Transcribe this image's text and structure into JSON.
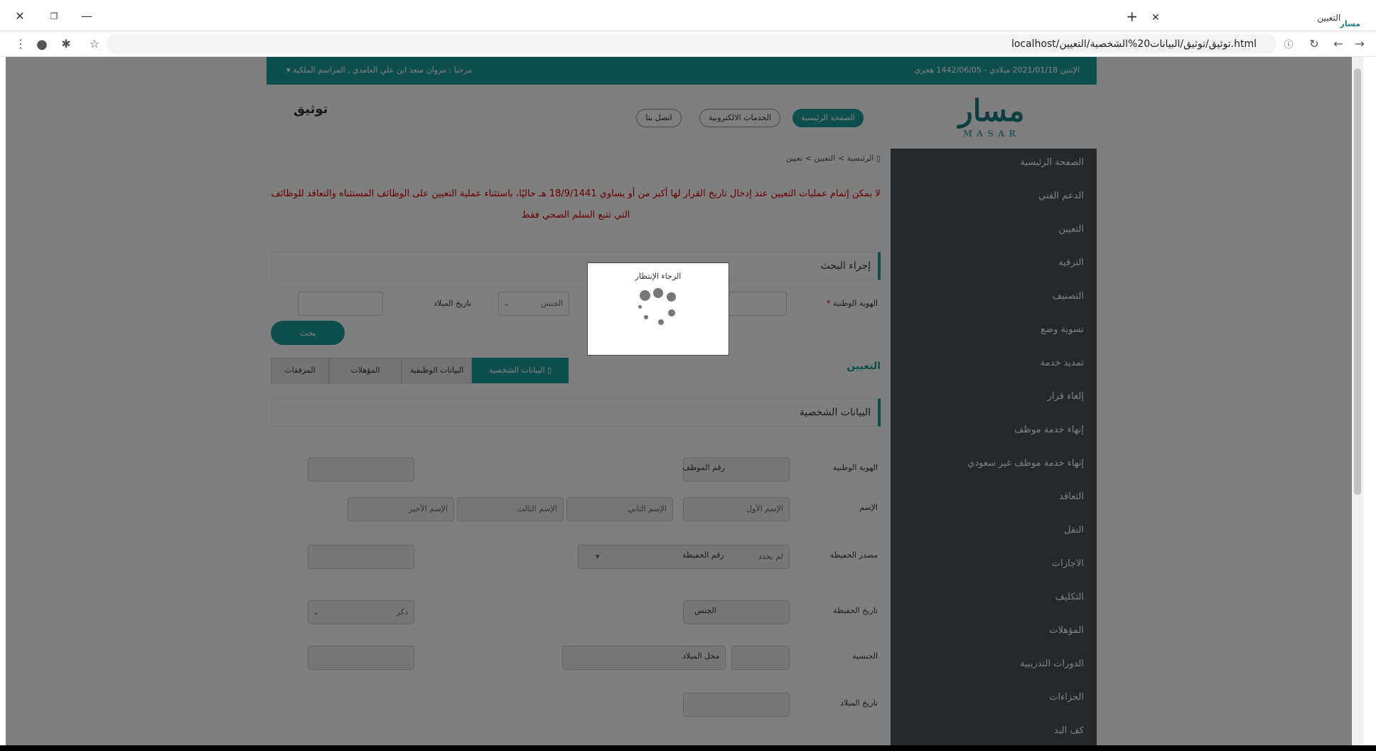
{
  "browser": {
    "tab_title": "التعيين",
    "tab_favicon": "masar-favicon",
    "url": "localhost/توثيق/توثيق/البيانات20%الشخصية/التعيين.html",
    "window_controls": {
      "close": "✕",
      "restore": "❐",
      "minimize": "—"
    },
    "new_tab": "+",
    "tab_close": "✕"
  },
  "header": {
    "date_text": "الإثنين 2021/01/18 ميلادي - 1442/06/05 هجري",
    "greeting": "مرحبا : مروان سعد ابن علي العامدي , المراسم الملكية ▾"
  },
  "brand": {
    "logo_text": "مسار",
    "logo_sub": "MASAR",
    "site_title": "توثيق",
    "nav": [
      "الصفحة الرئيسية",
      "الخدمات الالكترونية",
      "اتصل بنا"
    ]
  },
  "sidebar": {
    "items": [
      "الصفحة الرئيسية",
      "الدعم الفني",
      "التعيين",
      "الترقية",
      "التصنيف",
      "تسوية وضع",
      "تمديد خدمة",
      "إلغاء قرار",
      "إنهاء خدمة موظف",
      "إنهاء خدمة موظف غير سعودي",
      "التعاقد",
      "النقل",
      "الاجازات",
      "التكليف",
      "المؤهلات",
      "الدورات التدريبية",
      "الجزاءات",
      "كف اليد"
    ]
  },
  "breadcrumb": "الرئيسية > التعيين > تعيين",
  "alert": "لا يمكن إتمام عمليات التعيين عند إدخال تاريخ القرار لها أكبر من أو يساوي 18/9/1441 هـ حاليًا، باستثناء عملية التعيين على الوظائف المستثناه والتعاقد للوظائف التي تتبع السلم الصحي فقط",
  "search": {
    "section_title": "إجراء البحث",
    "national_id_label": "الهوية الوطنية",
    "required_mark": "*",
    "gender_placeholder": "الجنس",
    "birthdate_label": "تاريخ الميلاد",
    "button": "بحث"
  },
  "tayin_heading": "التعيين",
  "tabs": [
    "البيانات الشخصية",
    "البيانات الوظيفية",
    "المؤهلات",
    "المرفقات"
  ],
  "personal": {
    "section_title": "البيانات الشخصية",
    "national_id": "الهوية الوطنية",
    "employee_no": "رقم الموظف",
    "name": "الإسم",
    "first_name": "الإسم الأول",
    "second_name": "الإسم الثاني",
    "third_name": "الإسم الثالث",
    "last_name": "الإسم الأخير",
    "file_source": "مصدر الحفيظة",
    "file_source_value": "لم يحدد",
    "file_no": "رقم الحفيظة",
    "file_date": "تاريخ الحفيظة",
    "gender": "الجنس",
    "gender_value": "ذكر",
    "nationality": "الجنسية",
    "birth_place": "محل الميلاد",
    "birth_date": "تاريخ الميلاد"
  },
  "modal": {
    "title": "الرجاء الإنتظار"
  }
}
